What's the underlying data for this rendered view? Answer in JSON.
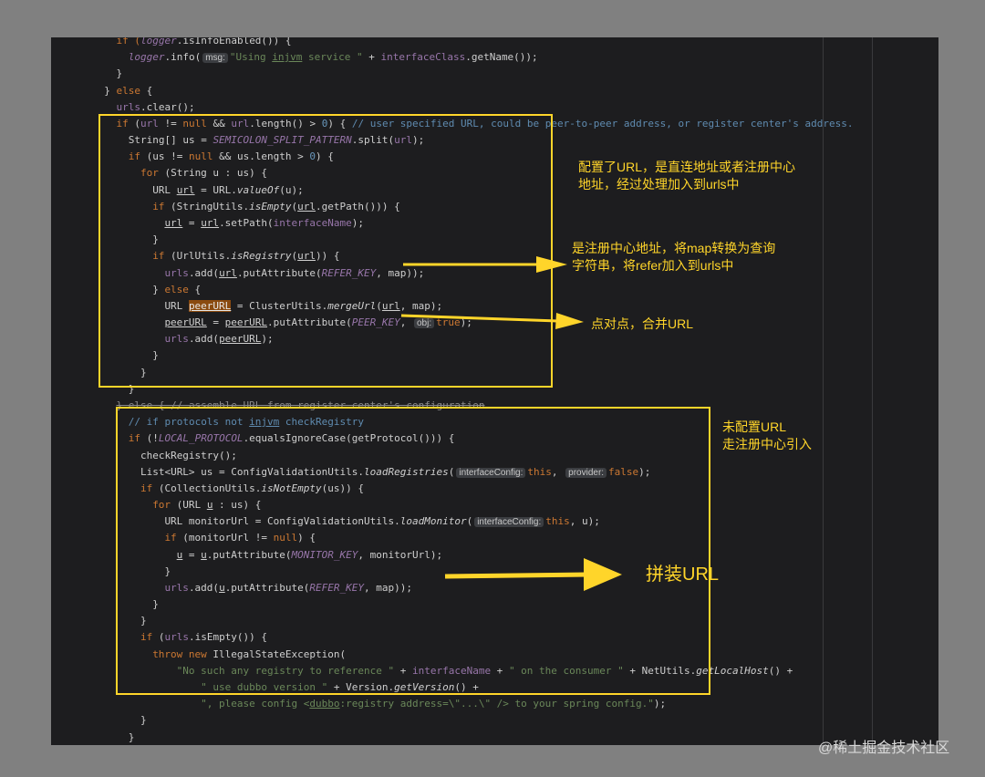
{
  "code_lines": [
    {
      "indent": 4,
      "tokens": [
        {
          "t": "if (",
          "c": "kw"
        },
        {
          "t": "logger",
          "c": "m"
        },
        {
          "t": ".isInfoEnabled()) {"
        }
      ]
    },
    {
      "indent": 6,
      "tokens": [
        {
          "t": "logger",
          "c": "m"
        },
        {
          "t": ".info("
        },
        {
          "h": "msg:"
        },
        {
          "t": "\"Using ",
          "c": "str"
        },
        {
          "t": "injvm",
          "c": "str",
          "u": true
        },
        {
          "t": " service \"",
          "c": "str"
        },
        {
          "t": " + "
        },
        {
          "t": "interfaceClass",
          "c": "f"
        },
        {
          "t": ".getName());"
        }
      ]
    },
    {
      "indent": 4,
      "tokens": [
        {
          "t": "}"
        }
      ]
    },
    {
      "indent": 2,
      "tokens": [
        {
          "t": "} "
        },
        {
          "t": "else",
          "c": "kw"
        },
        {
          "t": " {"
        }
      ]
    },
    {
      "indent": 4,
      "tokens": [
        {
          "t": "urls",
          "c": "f"
        },
        {
          "t": ".clear();"
        }
      ]
    },
    {
      "indent": 4,
      "tokens": [
        {
          "t": "if",
          "c": "kw"
        },
        {
          "t": " ("
        },
        {
          "t": "url",
          "c": "f"
        },
        {
          "t": " != "
        },
        {
          "t": "null",
          "c": "lit"
        },
        {
          "t": " && "
        },
        {
          "t": "url",
          "c": "f"
        },
        {
          "t": ".length() > "
        },
        {
          "t": "0",
          "c": "n"
        },
        {
          "t": ") { "
        },
        {
          "t": "// user specified URL, could be peer-to-peer address, or register center's address.",
          "c": "cm"
        }
      ]
    },
    {
      "indent": 6,
      "tokens": [
        {
          "t": "String[] us = "
        },
        {
          "t": "SEMICOLON_SPLIT_PATTERN",
          "c": "m"
        },
        {
          "t": ".split("
        },
        {
          "t": "url",
          "c": "f"
        },
        {
          "t": ");"
        }
      ]
    },
    {
      "indent": 6,
      "tokens": [
        {
          "t": "if",
          "c": "kw"
        },
        {
          "t": " (us != "
        },
        {
          "t": "null",
          "c": "lit"
        },
        {
          "t": " && us.length > "
        },
        {
          "t": "0",
          "c": "n"
        },
        {
          "t": ") {"
        }
      ]
    },
    {
      "indent": 8,
      "tokens": [
        {
          "t": "for",
          "c": "kw"
        },
        {
          "t": " (String u : us) {"
        }
      ]
    },
    {
      "indent": 10,
      "tokens": [
        {
          "t": "URL "
        },
        {
          "t": "url",
          "u": true
        },
        {
          "t": " = URL."
        },
        {
          "t": "valueOf",
          "c": "st"
        },
        {
          "t": "(u);"
        }
      ]
    },
    {
      "indent": 10,
      "tokens": [
        {
          "t": "if",
          "c": "kw"
        },
        {
          "t": " (StringUtils."
        },
        {
          "t": "isEmpty",
          "c": "st"
        },
        {
          "t": "("
        },
        {
          "t": "url",
          "u": true
        },
        {
          "t": ".getPath())) {"
        }
      ]
    },
    {
      "indent": 12,
      "tokens": [
        {
          "t": "url",
          "u": true
        },
        {
          "t": " = "
        },
        {
          "t": "url",
          "u": true
        },
        {
          "t": ".setPath("
        },
        {
          "t": "interfaceName",
          "c": "f"
        },
        {
          "t": ");"
        }
      ]
    },
    {
      "indent": 10,
      "tokens": [
        {
          "t": "}"
        }
      ]
    },
    {
      "indent": 10,
      "tokens": [
        {
          "t": "if",
          "c": "kw"
        },
        {
          "t": " (UrlUtils."
        },
        {
          "t": "isRegistry",
          "c": "st"
        },
        {
          "t": "("
        },
        {
          "t": "url",
          "u": true
        },
        {
          "t": ")) {"
        }
      ]
    },
    {
      "indent": 12,
      "tokens": [
        {
          "t": "urls",
          "c": "f"
        },
        {
          "t": ".add("
        },
        {
          "t": "url",
          "u": true
        },
        {
          "t": ".putAttribute("
        },
        {
          "t": "REFER_KEY",
          "c": "m"
        },
        {
          "t": ", map));"
        }
      ]
    },
    {
      "indent": 10,
      "tokens": [
        {
          "t": "} "
        },
        {
          "t": "else",
          "c": "kw"
        },
        {
          "t": " {"
        }
      ]
    },
    {
      "indent": 12,
      "tokens": [
        {
          "t": "URL "
        },
        {
          "t": "peerURL",
          "hl": true,
          "u": true
        },
        {
          "t": " = ClusterUtils."
        },
        {
          "t": "mergeUrl",
          "c": "st"
        },
        {
          "t": "("
        },
        {
          "t": "url",
          "u": true
        },
        {
          "t": ", map);"
        }
      ]
    },
    {
      "indent": 12,
      "tokens": [
        {
          "t": "peerURL",
          "u": true
        },
        {
          "t": " = "
        },
        {
          "t": "peerURL",
          "u": true
        },
        {
          "t": ".putAttribute("
        },
        {
          "t": "PEER_KEY",
          "c": "m"
        },
        {
          "t": ", "
        },
        {
          "h": "obj:"
        },
        {
          "t": "true",
          "c": "lit"
        },
        {
          "t": ");"
        }
      ]
    },
    {
      "indent": 12,
      "tokens": [
        {
          "t": "urls",
          "c": "f"
        },
        {
          "t": ".add("
        },
        {
          "t": "peerURL",
          "u": true
        },
        {
          "t": ");"
        }
      ]
    },
    {
      "indent": 10,
      "tokens": [
        {
          "t": "}"
        }
      ]
    },
    {
      "indent": 8,
      "tokens": [
        {
          "t": "}"
        }
      ]
    },
    {
      "indent": 6,
      "tokens": [
        {
          "t": "}"
        }
      ]
    },
    {
      "indent": 4,
      "tokens": [
        {
          "t": "} else { // assemble URL from register center's configuration",
          "strike": true
        }
      ]
    },
    {
      "indent": 6,
      "tokens": [
        {
          "t": "// if protocols not ",
          "c": "cm"
        },
        {
          "t": "injvm",
          "c": "cm",
          "u": true
        },
        {
          "t": " checkRegistry",
          "c": "cm"
        }
      ]
    },
    {
      "indent": 6,
      "tokens": [
        {
          "t": "if",
          "c": "kw"
        },
        {
          "t": " (!"
        },
        {
          "t": "LOCAL_PROTOCOL",
          "c": "m"
        },
        {
          "t": ".equalsIgnoreCase(getProtocol())) {"
        }
      ]
    },
    {
      "indent": 8,
      "tokens": [
        {
          "t": "checkRegistry();"
        }
      ]
    },
    {
      "indent": 8,
      "tokens": [
        {
          "t": "List<URL> us = ConfigValidationUtils."
        },
        {
          "t": "loadRegistries",
          "c": "st"
        },
        {
          "t": "("
        },
        {
          "h": "interfaceConfig:"
        },
        {
          "t": "this",
          "c": "lit"
        },
        {
          "t": ", "
        },
        {
          "h": "provider:"
        },
        {
          "t": "false",
          "c": "lit"
        },
        {
          "t": ");"
        }
      ]
    },
    {
      "indent": 8,
      "tokens": [
        {
          "t": "if",
          "c": "kw"
        },
        {
          "t": " (CollectionUtils."
        },
        {
          "t": "isNotEmpty",
          "c": "st"
        },
        {
          "t": "(us)) {"
        }
      ]
    },
    {
      "indent": 10,
      "tokens": [
        {
          "t": "for",
          "c": "kw"
        },
        {
          "t": " (URL "
        },
        {
          "t": "u",
          "u": true
        },
        {
          "t": " : us) {"
        }
      ]
    },
    {
      "indent": 12,
      "tokens": [
        {
          "t": "URL monitorUrl = ConfigValidationUtils."
        },
        {
          "t": "loadMonitor",
          "c": "st"
        },
        {
          "t": "("
        },
        {
          "h": "interfaceConfig:"
        },
        {
          "t": "this",
          "c": "lit"
        },
        {
          "t": ", u);"
        }
      ]
    },
    {
      "indent": 12,
      "tokens": [
        {
          "t": "if",
          "c": "kw"
        },
        {
          "t": " (monitorUrl != "
        },
        {
          "t": "null",
          "c": "lit"
        },
        {
          "t": ") {"
        }
      ]
    },
    {
      "indent": 14,
      "tokens": [
        {
          "t": "u",
          "u": true
        },
        {
          "t": " = "
        },
        {
          "t": "u",
          "u": true
        },
        {
          "t": ".putAttribute("
        },
        {
          "t": "MONITOR_KEY",
          "c": "m"
        },
        {
          "t": ", monitorUrl);"
        }
      ]
    },
    {
      "indent": 12,
      "tokens": [
        {
          "t": "}"
        }
      ]
    },
    {
      "indent": 12,
      "tokens": [
        {
          "t": "urls",
          "c": "f"
        },
        {
          "t": ".add("
        },
        {
          "t": "u",
          "u": true
        },
        {
          "t": ".putAttribute("
        },
        {
          "t": "REFER_KEY",
          "c": "m"
        },
        {
          "t": ", map));"
        }
      ]
    },
    {
      "indent": 10,
      "tokens": [
        {
          "t": "}"
        }
      ]
    },
    {
      "indent": 8,
      "tokens": [
        {
          "t": "}"
        }
      ]
    },
    {
      "indent": 8,
      "tokens": [
        {
          "t": "if",
          "c": "kw"
        },
        {
          "t": " ("
        },
        {
          "t": "urls",
          "c": "f"
        },
        {
          "t": ".isEmpty()) {"
        }
      ]
    },
    {
      "indent": 10,
      "tokens": [
        {
          "t": "throw new",
          "c": "kw"
        },
        {
          "t": " IllegalStateException("
        }
      ]
    },
    {
      "indent": 14,
      "tokens": [
        {
          "t": "\"No such any registry to reference \"",
          "c": "str"
        },
        {
          "t": " + "
        },
        {
          "t": "interfaceName",
          "c": "f"
        },
        {
          "t": " + "
        },
        {
          "t": "\" on the consumer \"",
          "c": "str"
        },
        {
          "t": " + NetUtils."
        },
        {
          "t": "getLocalHost",
          "c": "st"
        },
        {
          "t": "() +"
        }
      ]
    },
    {
      "indent": 18,
      "tokens": [
        {
          "t": "\" use dubbo version \"",
          "c": "str"
        },
        {
          "t": " + Version."
        },
        {
          "t": "getVersion",
          "c": "st"
        },
        {
          "t": "() +"
        }
      ]
    },
    {
      "indent": 18,
      "tokens": [
        {
          "t": "\", please config <",
          "c": "str"
        },
        {
          "t": "dubbo",
          "c": "str",
          "u": true
        },
        {
          "t": ":registry address=\\\"...\\\" /> to your spring config.\"",
          "c": "str"
        },
        {
          "t": ");"
        }
      ]
    },
    {
      "indent": 8,
      "tokens": [
        {
          "t": "}"
        }
      ]
    },
    {
      "indent": 6,
      "tokens": [
        {
          "t": "}"
        }
      ]
    }
  ],
  "annotations": {
    "note1": "配置了URL，是直连地址或者注册中心\n地址，经过处理加入到urls中",
    "note2": "是注册中心地址，将map转换为查询\n字符串，将refer加入到urls中",
    "note3": "点对点，合并URL",
    "note4": "未配置URL\n走注册中心引入",
    "note5": "拼装URL"
  },
  "watermark": "@稀土掘金技术社区",
  "colors": {
    "annotation": "#ffd52a",
    "editor_bg": "#1d1d1f",
    "page_bg": "#808080",
    "keyword": "#cc7832",
    "string": "#6a8759",
    "comment": "#5f8bb0",
    "field": "#9876aa"
  }
}
